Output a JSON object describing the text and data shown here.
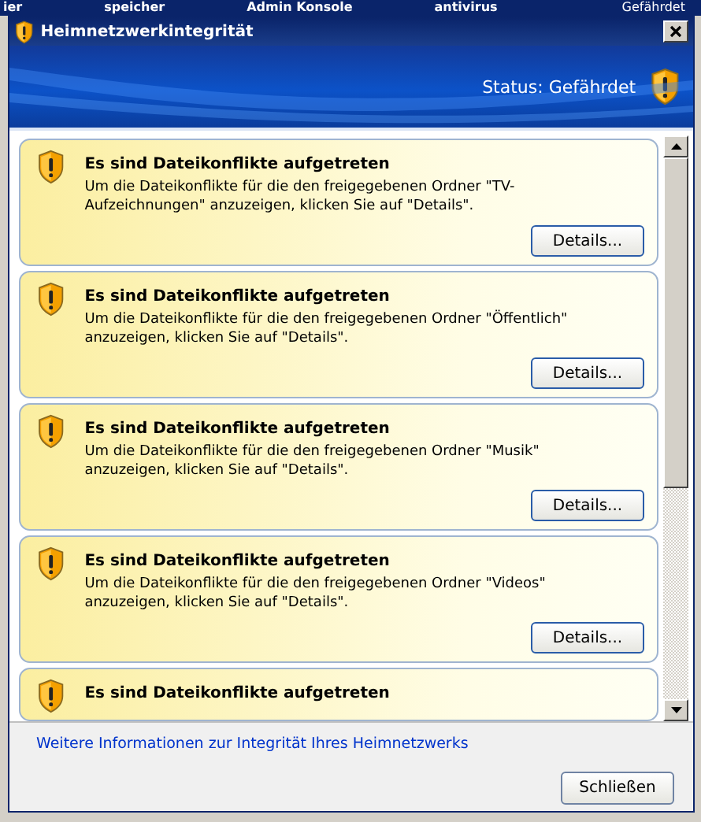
{
  "background_bar": {
    "items": [
      "ier",
      "speicher",
      "Admin Konsole",
      "antivirus",
      "Gefährdet"
    ]
  },
  "window": {
    "title": "Heimnetzwerkintegrität"
  },
  "banner": {
    "status": "Status: Gefährdet"
  },
  "alerts": [
    {
      "title": "Es sind Dateikonflikte aufgetreten",
      "text": "Um die Dateikonflikte für die den freigegebenen Ordner \"TV-Aufzeichnungen\" anzuzeigen, klicken Sie auf \"Details\".",
      "button": "Details..."
    },
    {
      "title": "Es sind Dateikonflikte aufgetreten",
      "text": "Um die Dateikonflikte für die den freigegebenen Ordner \"Öffentlich\" anzuzeigen, klicken Sie auf \"Details\".",
      "button": "Details..."
    },
    {
      "title": "Es sind Dateikonflikte aufgetreten",
      "text": "Um die Dateikonflikte für die den freigegebenen Ordner \"Musik\" anzuzeigen, klicken Sie auf \"Details\".",
      "button": "Details..."
    },
    {
      "title": "Es sind Dateikonflikte aufgetreten",
      "text": "Um die Dateikonflikte für die den freigegebenen Ordner \"Videos\" anzuzeigen, klicken Sie auf \"Details\".",
      "button": "Details..."
    },
    {
      "title": "Es sind Dateikonflikte aufgetreten"
    }
  ],
  "footer": {
    "link": "Weitere Informationen zur Integrität Ihres Heimnetzwerks",
    "button": "Schließen"
  }
}
